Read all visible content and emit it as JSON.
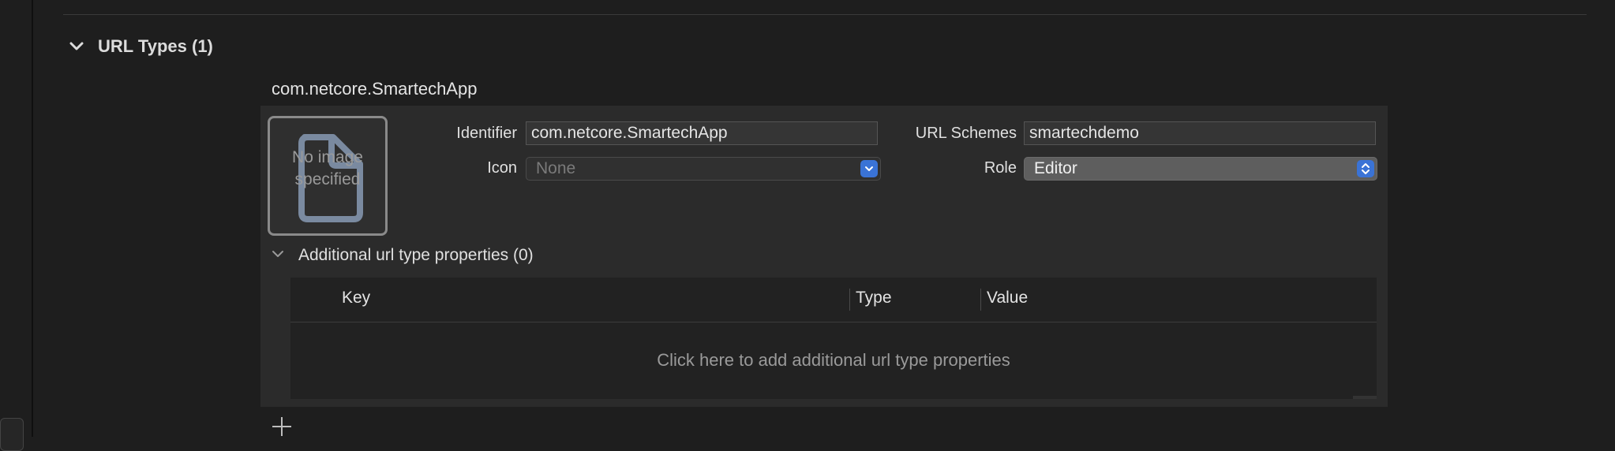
{
  "section": {
    "title": "URL Types (1)"
  },
  "entry": {
    "name": "com.netcore.SmartechApp",
    "image_well_text": "No image specified",
    "fields": {
      "identifier_label": "Identifier",
      "identifier_value": "com.netcore.SmartechApp",
      "icon_label": "Icon",
      "icon_value": "None",
      "url_schemes_label": "URL Schemes",
      "url_schemes_value": "smartechdemo",
      "role_label": "Role",
      "role_value": "Editor"
    },
    "additional": {
      "title": "Additional url type properties (0)",
      "columns": [
        "Key",
        "Type",
        "Value"
      ],
      "empty_text": "Click here to add additional url type properties"
    }
  },
  "colors": {
    "accent": "#3a73d6",
    "background": "#1e1e1e",
    "panel": "#2b2b2b"
  },
  "icons": {
    "section_toggle": "chevron-down-icon",
    "subsection_toggle": "chevron-down-icon",
    "image_placeholder": "document-icon",
    "add": "plus-icon",
    "icon_popup": "chevron-down-icon",
    "role_popup": "up-down-chevron-icon"
  }
}
